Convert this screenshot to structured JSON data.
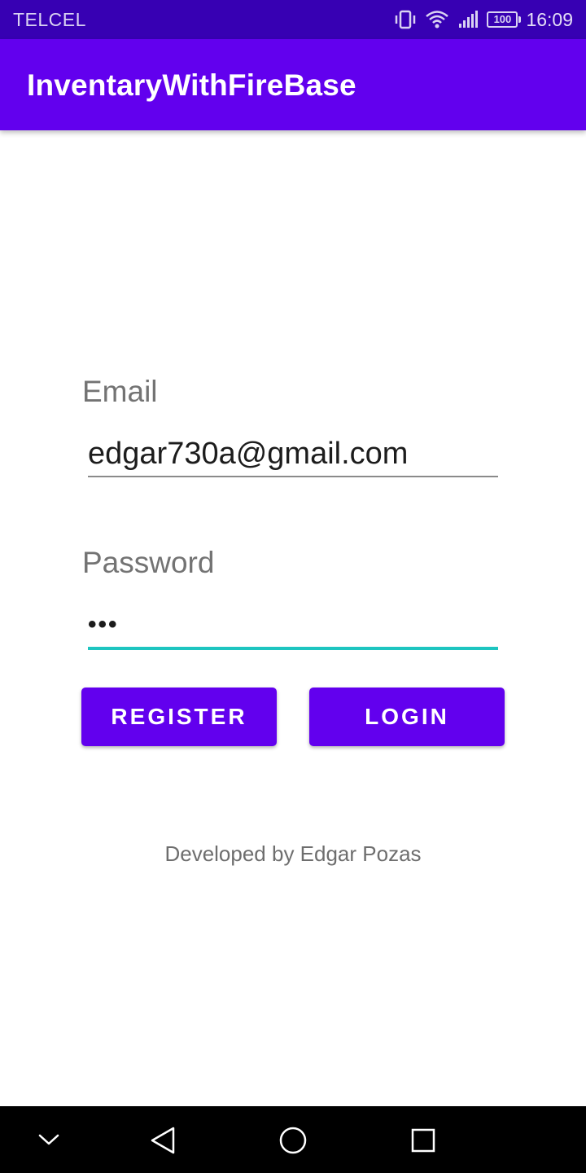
{
  "status_bar": {
    "carrier": "TELCEL",
    "battery": "100",
    "time": "16:09",
    "icons": [
      "vibrate-icon",
      "wifi-icon",
      "signal-icon",
      "battery-icon"
    ]
  },
  "app_bar": {
    "title": "InventaryWithFireBase"
  },
  "form": {
    "email_label": "Email",
    "email_value": "edgar730a@gmail.com",
    "password_label": "Password",
    "password_value": "•••"
  },
  "buttons": {
    "register_label": "REGISTER",
    "login_label": "LOGIN"
  },
  "footer": {
    "credit": "Developed by Edgar Pozas"
  },
  "nav_bar": {
    "icons": [
      "chevron-down-icon",
      "back-icon",
      "home-icon",
      "recents-icon"
    ]
  },
  "colors": {
    "status_bar": "#3700b3",
    "primary": "#6200ee",
    "accent": "#1ec5c0",
    "nav_bar": "#000000"
  }
}
